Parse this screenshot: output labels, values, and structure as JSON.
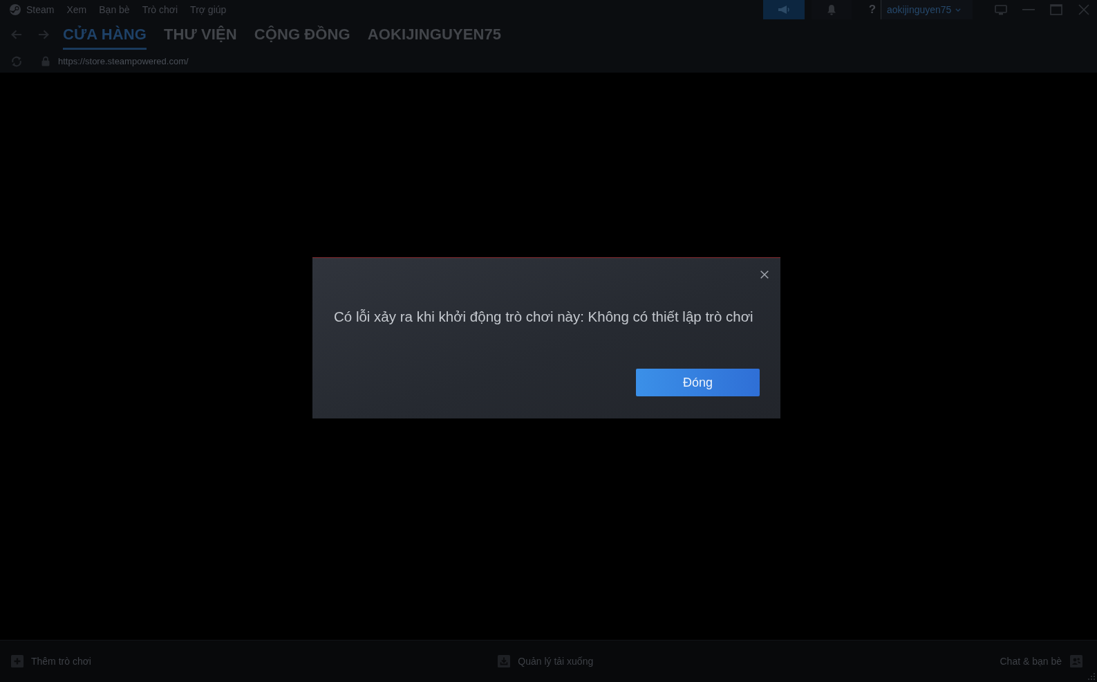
{
  "menu_bar": {
    "app_menu": "Steam",
    "items": [
      "Xem",
      "Bạn bè",
      "Trò chơi",
      "Trợ giúp"
    ],
    "help": "?",
    "user": "aokijinguyen75"
  },
  "nav_tabs": [
    {
      "label": "CỬA HÀNG",
      "selected": true
    },
    {
      "label": "THƯ VIỆN",
      "selected": false
    },
    {
      "label": "CỘNG ĐỒNG",
      "selected": false
    },
    {
      "label": "AOKIJINGUYEN75",
      "selected": false
    }
  ],
  "address_bar": {
    "url": "https://store.steampowered.com/"
  },
  "dialog": {
    "message": "Có lỗi xảy ra khi khởi động trò chơi này: Không có thiết lập trò chơi",
    "button": "Đóng"
  },
  "bottom_bar": {
    "add_game": "Thêm trò chơi",
    "downloads": "Quản lý tải xuống",
    "friends": "Chat & bạn bè"
  }
}
